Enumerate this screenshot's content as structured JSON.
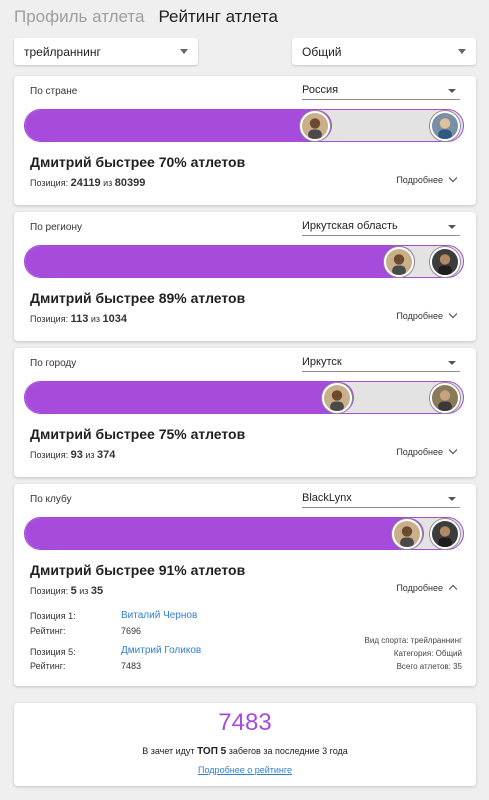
{
  "tabs": [
    "Профиль атлета",
    "Рейтинг атлета"
  ],
  "filters": {
    "sport": "трейлраннинг",
    "category": "Общий"
  },
  "colors": {
    "accent": "#a64bdc",
    "link": "#2f7fd1"
  },
  "cards": [
    {
      "label": "По стране",
      "select": "Россия",
      "percent": 70,
      "headline": "Дмитрий быстрее 70% атлетов",
      "position_label": "Позиция:",
      "position": "24119",
      "of_label": "из",
      "total": "80399",
      "more": "Подробнее"
    },
    {
      "label": "По региону",
      "select": "Иркутская область",
      "percent": 89,
      "headline": "Дмитрий быстрее 89% атлетов",
      "position_label": "Позиция:",
      "position": "113",
      "of_label": "из",
      "total": "1034",
      "more": "Подробнее"
    },
    {
      "label": "По городу",
      "select": "Иркутск",
      "percent": 75,
      "headline": "Дмитрий быстрее 75% атлетов",
      "position_label": "Позиция:",
      "position": "93",
      "of_label": "из",
      "total": "374",
      "more": "Подробнее"
    },
    {
      "label": "По клубу",
      "select": "BlackLynx",
      "percent": 91,
      "headline": "Дмитрий быстрее 91% атлетов",
      "position_label": "Позиция:",
      "position": "5",
      "of_label": "из",
      "total": "35",
      "more": "Подробнее"
    }
  ],
  "club_details": {
    "pos1_label": "Позиция 1:",
    "pos1_name": "Виталий Чернов",
    "rating_label": "Рейтинг:",
    "pos1_rating": "7696",
    "pos5_label": "Позиция 5:",
    "pos5_name": "Дмитрий Голиков",
    "pos5_rating": "7483",
    "sport_line": "Вид спорта: трейлраннинг",
    "category_line": "Категория: Общий",
    "total_line": "Всего атлетов: 35"
  },
  "summary": {
    "rating": "7483",
    "note_prefix": "В зачет идут",
    "note_top": "ТОП 5",
    "note_suffix": "забегов за последние 3 года",
    "link": "Подробнее о рейтинге"
  }
}
